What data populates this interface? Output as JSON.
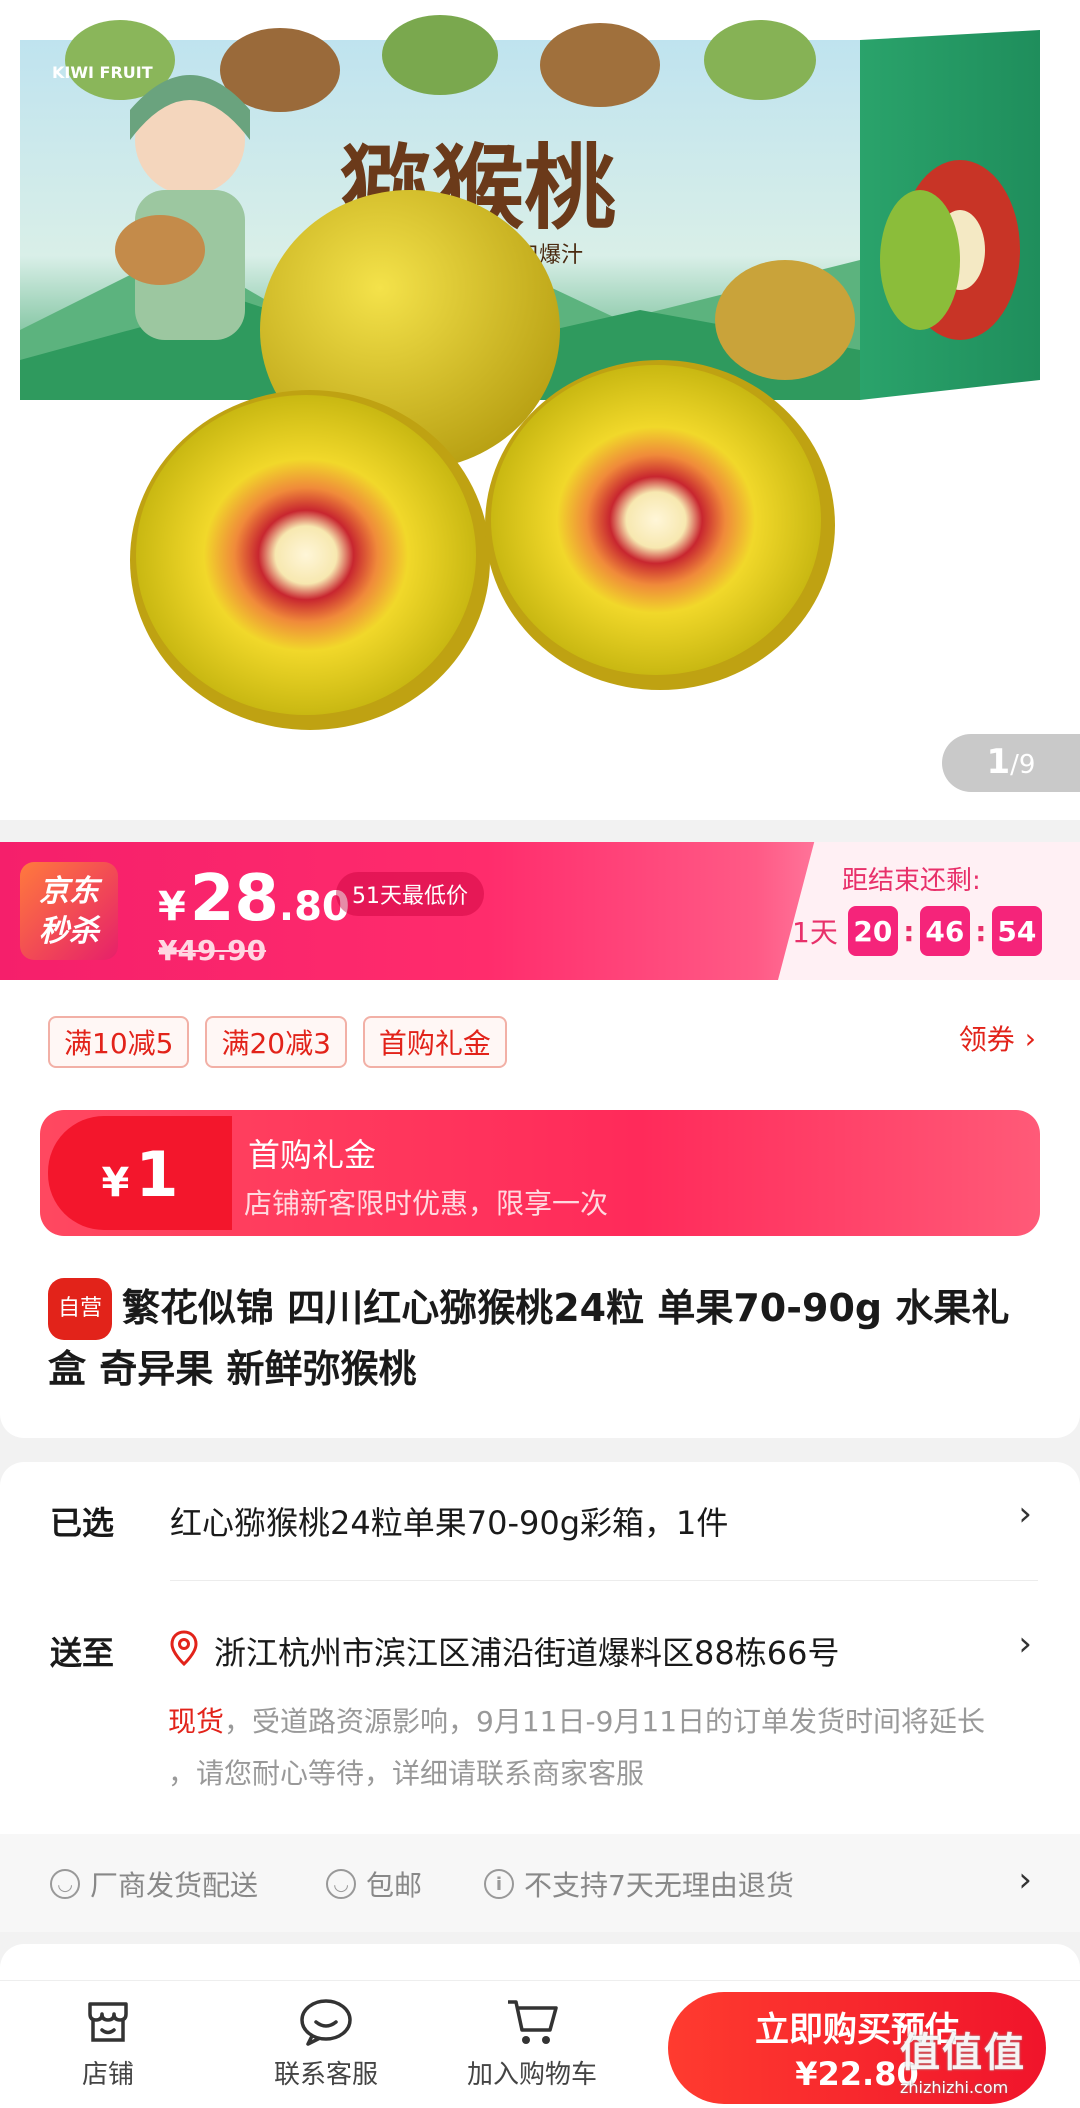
{
  "hero": {
    "box_brand": "KIWI FRUIT",
    "box_title": "猕猴桃",
    "box_slogan": "香甜爽口 一口爆汁",
    "page_current": "1",
    "page_total": "/9"
  },
  "seckill": {
    "logo_line1": "京东",
    "logo_line2": "秒杀",
    "currency": "¥",
    "price_int": "28",
    "price_dec": ".80",
    "lowest_badge": "51天最低价",
    "original_price": "¥49.90",
    "end_label": "距结束还剩:",
    "days": "1天",
    "hours": "20",
    "minutes": "46",
    "seconds": "54",
    "colon": ":"
  },
  "coupons": {
    "items": [
      "满10减5",
      "满20减3",
      "首购礼金"
    ],
    "get_label": "领券",
    "get_chevron": "›"
  },
  "newbie": {
    "currency": "¥",
    "amount": "1",
    "title": "首购礼金",
    "desc": "店铺新客限时优惠，限享一次"
  },
  "product": {
    "badge": "自营",
    "title": "繁花似锦 四川红心猕猴桃24粒 单果70-90g 水果礼盒 奇异果 新鲜弥猴桃"
  },
  "selection": {
    "label": "已选",
    "value": "红心猕猴桃24粒单果70-90g彩箱，1件",
    "chevron": "›"
  },
  "delivery": {
    "label": "送至",
    "address": "浙江杭州市滨江区浦沿街道爆料区88栋66号",
    "chevron": "›",
    "stock_status": "现货",
    "stock_note_1": "，受道路资源影响，9月11日-9月11日的订单发货时间将延长",
    "stock_note_2": "，请您耐心等待，详细请联系商家客服"
  },
  "services": {
    "items": [
      {
        "icon": "smile",
        "label": "厂商发货配送"
      },
      {
        "icon": "smile",
        "label": "包邮"
      },
      {
        "icon": "info",
        "label": "不支持7天无理由退货"
      }
    ],
    "chevron": "›"
  },
  "bottom_bar": {
    "store": "店铺",
    "service": "联系客服",
    "cart": "加入购物车",
    "buy_line1": "立即购买预估",
    "buy_line2": "¥22.80"
  },
  "watermark": {
    "big": "值值值",
    "small": "zhizhizhi.com"
  },
  "colors": {
    "jd_red": "#e2231a",
    "seckill_pink": "#f5247a",
    "kiwi_yellow": "#e3d21a"
  }
}
